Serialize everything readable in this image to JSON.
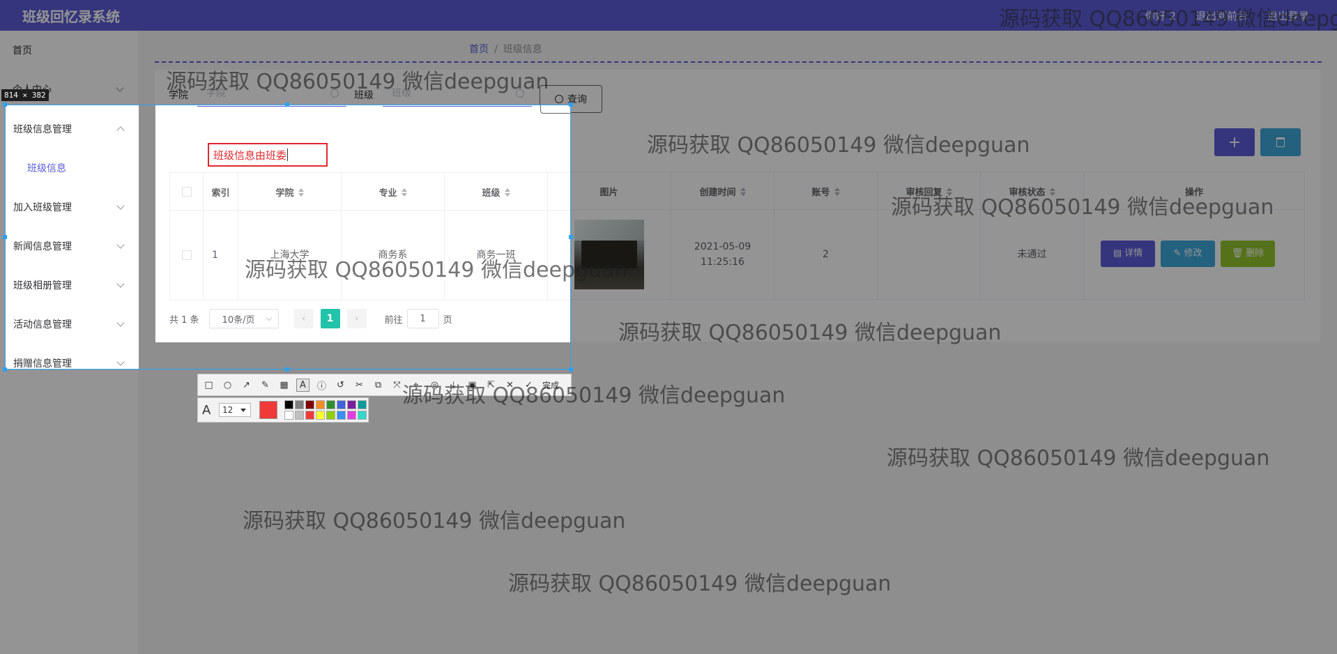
{
  "app": {
    "title": "班级回忆录系统"
  },
  "header": {
    "right_items": [
      "你好 2",
      "退出到前台",
      "退出登录"
    ]
  },
  "sidebar": {
    "items": [
      {
        "label": "首页"
      },
      {
        "label": "个人中心"
      },
      {
        "label": "班级信息管理"
      },
      {
        "label": "班级信息"
      },
      {
        "label": "加入班级管理"
      },
      {
        "label": "新闻信息管理"
      },
      {
        "label": "班级相册管理"
      },
      {
        "label": "活动信息管理"
      },
      {
        "label": "捐赠信息管理"
      }
    ]
  },
  "breadcrumb": {
    "home": "首页",
    "sep": "/",
    "current": "班级信息"
  },
  "filters": {
    "college_label": "学院",
    "college_placeholder": "学院",
    "class_label": "班级",
    "class_placeholder": "班级",
    "query_button": "查询"
  },
  "toolbar": {
    "add_label": "+"
  },
  "table": {
    "columns": [
      "索引",
      "学院",
      "专业",
      "班级",
      "图片",
      "创建时间",
      "账号",
      "审核回复",
      "审核状态",
      "操作"
    ],
    "rows": [
      {
        "index": "1",
        "college": "上海大学",
        "major": "商务系",
        "class": "商务一班",
        "created_at": "2021-05-09 11:25:16",
        "account": "2",
        "reply": "",
        "status": "未通过",
        "actions": [
          "详情",
          "修改",
          "删除"
        ]
      }
    ]
  },
  "pagination": {
    "total": "共 1 条",
    "page_size": "10条/页",
    "prev": "‹",
    "current_page": "1",
    "next": "›",
    "goto_label": "前往",
    "goto_value": "1",
    "page_unit": "页"
  },
  "screenshot_tool": {
    "size_label": "814 × 382",
    "annotation_text": "班级信息由班委",
    "font_size": "12",
    "done_label": "完成",
    "current_color": "#f03a3a",
    "palette": [
      "#000000",
      "#808080",
      "#800000",
      "#f28c28",
      "#2f8f2f",
      "#3f63d9",
      "#7a1fa2",
      "#0f9a9a",
      "#ffffff",
      "#c0c0c0",
      "#f03a3a",
      "#ffff33",
      "#8fd000",
      "#3a8ef6",
      "#e33ce3",
      "#33d6c9"
    ]
  },
  "watermark": {
    "text": "源码获取 QQ86050149 微信deepguan"
  }
}
